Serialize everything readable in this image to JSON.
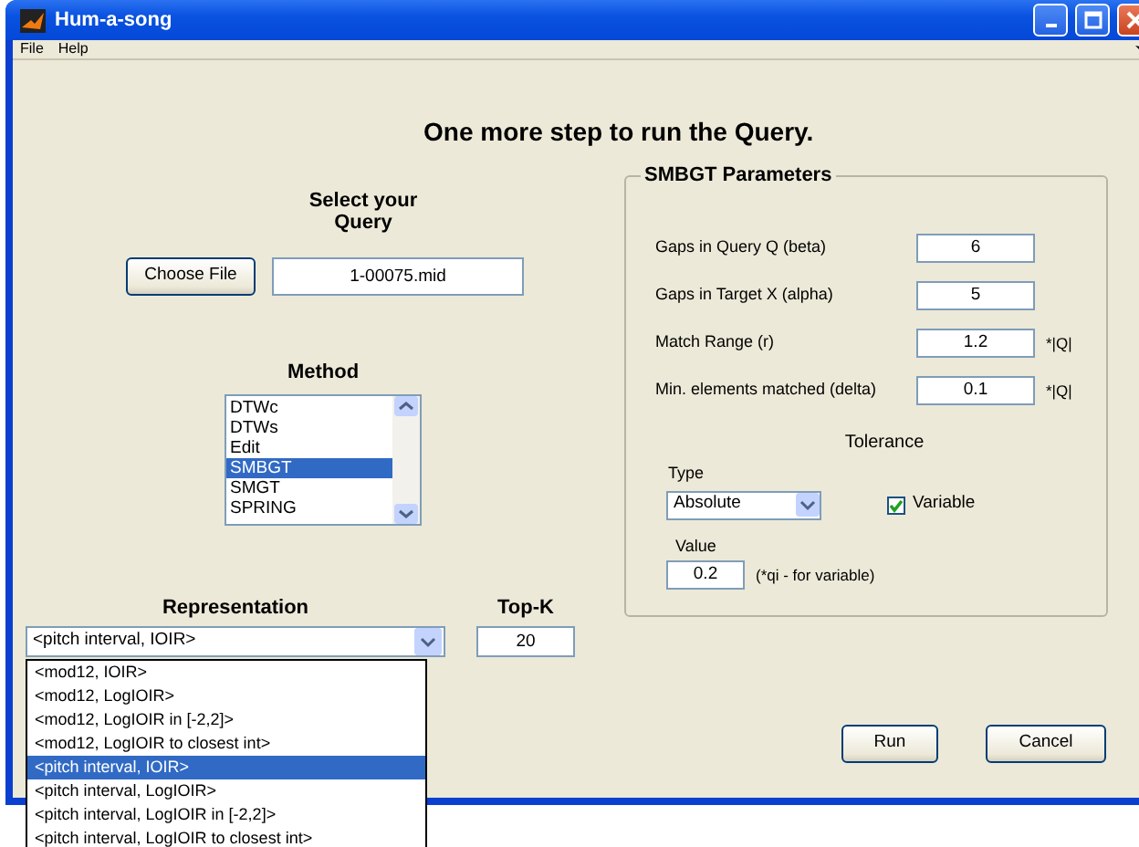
{
  "window": {
    "title": "Hum-a-song"
  },
  "menu": [
    "File",
    "Help"
  ],
  "heading": "One more step to run the Query.",
  "query": {
    "label": "Select your Query",
    "button": "Choose File",
    "file": "1-00075.mid"
  },
  "method": {
    "label": "Method",
    "options": [
      {
        "label": "DTWc",
        "selected": false
      },
      {
        "label": "DTWs",
        "selected": false
      },
      {
        "label": "Edit",
        "selected": false
      },
      {
        "label": "SMBGT",
        "selected": true
      },
      {
        "label": "SMGT",
        "selected": false
      },
      {
        "label": "SPRING",
        "selected": false
      }
    ]
  },
  "representation": {
    "label": "Representation",
    "value": "<pitch interval, IOIR>",
    "expanded": true,
    "options": [
      {
        "label": "<mod12, IOIR>",
        "selected": false
      },
      {
        "label": "<mod12, LogIOIR>",
        "selected": false
      },
      {
        "label": "<mod12, LogIOIR in [-2,2]>",
        "selected": false
      },
      {
        "label": "<mod12, LogIOIR to closest int>",
        "selected": false
      },
      {
        "label": "<pitch interval, IOIR>",
        "selected": true
      },
      {
        "label": "<pitch interval, LogIOIR>",
        "selected": false
      },
      {
        "label": "<pitch interval, LogIOIR in [-2,2]>",
        "selected": false
      },
      {
        "label": "<pitch interval, LogIOIR to closest int>",
        "selected": false
      }
    ]
  },
  "top_k": {
    "label": "Top-K",
    "value": "20"
  },
  "parameters": {
    "title": "SMBGT Parameters",
    "fields": [
      {
        "label": "Gaps in Query Q (beta)",
        "value": "6"
      },
      {
        "label": "Gaps in Target X (alpha)",
        "value": "5"
      },
      {
        "label": "Match Range (r)",
        "value": "1.2",
        "unit": "*|Q|"
      },
      {
        "label": "Min. elements matched (delta)",
        "value": "0.1",
        "unit": "*|Q|"
      }
    ],
    "tolerance": {
      "title": "Tolerance",
      "type_label": "Type",
      "type_value": "Absolute",
      "variable": {
        "label": "Variable",
        "checked": true
      },
      "value_label": "Value",
      "value": "0.2",
      "note": "(*qi - for variable)"
    }
  },
  "buttons": [
    "Run",
    "Cancel"
  ]
}
